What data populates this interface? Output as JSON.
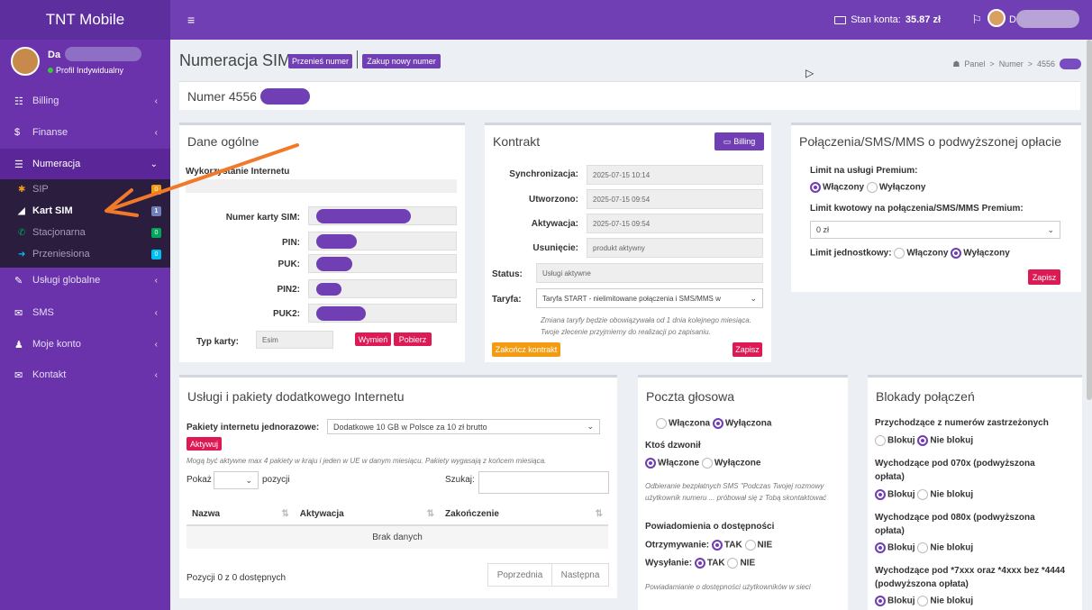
{
  "topbar": {
    "brand": "TNT Mobile",
    "menu_icon": "≡",
    "account_label": "Stan konta:",
    "account_value": "35.87 zł",
    "flag_icon": "⚐",
    "user_name": "Daw"
  },
  "sidebar": {
    "user": {
      "name": "Da",
      "status": "Profil Indywidualny"
    },
    "items": [
      {
        "label": "Billing",
        "icon": "☷",
        "chevron": "‹"
      },
      {
        "label": "Finanse",
        "icon": "$",
        "chevron": "‹"
      },
      {
        "label": "Numeracja",
        "icon": "☰",
        "chevron": "⌄"
      },
      {
        "label": "Usługi globalne",
        "icon": "✎",
        "chevron": "‹"
      },
      {
        "label": "SMS",
        "icon": "✉",
        "chevron": "‹"
      },
      {
        "label": "Moje konto",
        "icon": "♟",
        "chevron": "‹"
      },
      {
        "label": "Kontakt",
        "icon": "✉",
        "chevron": "‹"
      }
    ],
    "subitems": [
      {
        "label": "SIP",
        "icon": "✱",
        "badge": "0",
        "badge_color": "#f39c12"
      },
      {
        "label": "Kart SIM",
        "icon": "◢",
        "badge": "1",
        "badge_color": "#6f7fb8"
      },
      {
        "label": "Stacjonarna",
        "icon": "✆",
        "badge": "0",
        "badge_color": "#00a65a"
      },
      {
        "label": "Przeniesiona",
        "icon": "➜",
        "badge": "0",
        "badge_color": "#00c0ef"
      }
    ]
  },
  "header": {
    "title": "Numeracja SIM",
    "btn_port": "Przenieś numer",
    "btn_buy": "Zakup nowy numer",
    "breadcrumb": {
      "home_icon": "☗",
      "panel": "Panel",
      "sep": ">",
      "numer": "Numer",
      "num": "4556"
    }
  },
  "number": {
    "label": "Numer 4556"
  },
  "general": {
    "title": "Dane ogólne",
    "internet_label": "Wykorzystanie Internetu",
    "sim_label": "Numer karty SIM:",
    "pin_label": "PIN:",
    "puk_label": "PUK:",
    "pin2_label": "PIN2:",
    "puk2_label": "PUK2:",
    "type_label": "Typ karty:",
    "type_value": "Esim",
    "btn_replace": "Wymień",
    "btn_download": "Pobierz"
  },
  "contract": {
    "title": "Kontrakt",
    "billing_btn": "Billing",
    "sync_label": "Synchronizacja:",
    "sync_value": "2025-07-15 10:14",
    "created_label": "Utworzono:",
    "created_value": "2025-07-15 09:54",
    "activation_label": "Aktywacja:",
    "activation_value": "2025-07-15 09:54",
    "removal_label": "Usunięcie:",
    "removal_value": "produkt aktywny",
    "status_label": "Status:",
    "status_value": "Usługi aktywne",
    "tariff_label": "Taryfa:",
    "tariff_value": "Taryfa START - nielimitowane połączenia i SMS/MMS w",
    "note": "Zmiana taryfy będzie obowiązywała od 1 dnia kolejnego miesiąca. Twoje zlecenie przyjmiemy do realizacji po zapisaniu.",
    "btn_end": "Zakończ kontrakt",
    "btn_save": "Zapisz"
  },
  "premium": {
    "title": "Połączenia/SMS/MMS o podwyższonej opłacie",
    "limit_label": "Limit na usługi Premium:",
    "on": "Włączony",
    "off": "Wyłączony",
    "amount_label": "Limit kwotowy na połączenia/SMS/MMS Premium:",
    "amount_value": "0 zł",
    "unit_label": "Limit jednostkowy:",
    "btn_save": "Zapisz"
  },
  "internet": {
    "title": "Usługi i pakiety dodatkowego Internetu",
    "packages_label": "Pakiety internetu jednorazowe:",
    "packages_value": "Dodatkowe 10 GB w Polsce za 10 zł brutto",
    "btn_activate": "Aktywuj",
    "note": "Mogą być aktywne max 4 pakiety w kraju i jeden w UE w danym miesiącu. Pakiety wygasają z końcem miesiąca.",
    "show_label": "Pokaż",
    "show_suffix": "pozycji",
    "search_label": "Szukaj:",
    "columns": [
      "Nazwa",
      "Aktywacja",
      "Zakończenie"
    ],
    "empty": "Brak danych",
    "summary": "Pozycji 0 z 0 dostępnych",
    "prev": "Poprzednia",
    "next": "Następna"
  },
  "voicemail": {
    "title": "Poczta głosowa",
    "on": "Włączona",
    "off": "Wyłączona",
    "missed_label": "Ktoś dzwonił",
    "missed_on": "Włączone",
    "missed_off": "Wyłączone",
    "missed_note": "Odbieranie bezpłatnych SMS \"Podczas Twojej rozmowy użytkownik numeru ... próbował się z Tobą skontaktować",
    "avail_label": "Powiadomienia o dostępności",
    "recv_label": "Otrzymywanie:",
    "send_label": "Wysyłanie:",
    "yes": "TAK",
    "no": "NIE",
    "avail_note": "Powiadamianie o dostępności użytkowników w sieci"
  },
  "blocks": {
    "title": "Blokady połączeń",
    "block": "Blokuj",
    "noblock": "Nie blokuj",
    "items": [
      {
        "label": "Przychodzące z numerów zastrzeżonych"
      },
      {
        "label": "Wychodzące pod 070x (podwyższona opłata)"
      },
      {
        "label": "Wychodzące pod 080x (podwyższona opłata)"
      },
      {
        "label": "Wychodzące pod *7xxx oraz *4xxx bez *4444 (podwyższona opłata)"
      }
    ]
  },
  "colors": {
    "accent": "#6f3fb3",
    "sidebar": "#6a33ab",
    "danger": "#dd1a54",
    "warning": "#f39c12"
  }
}
